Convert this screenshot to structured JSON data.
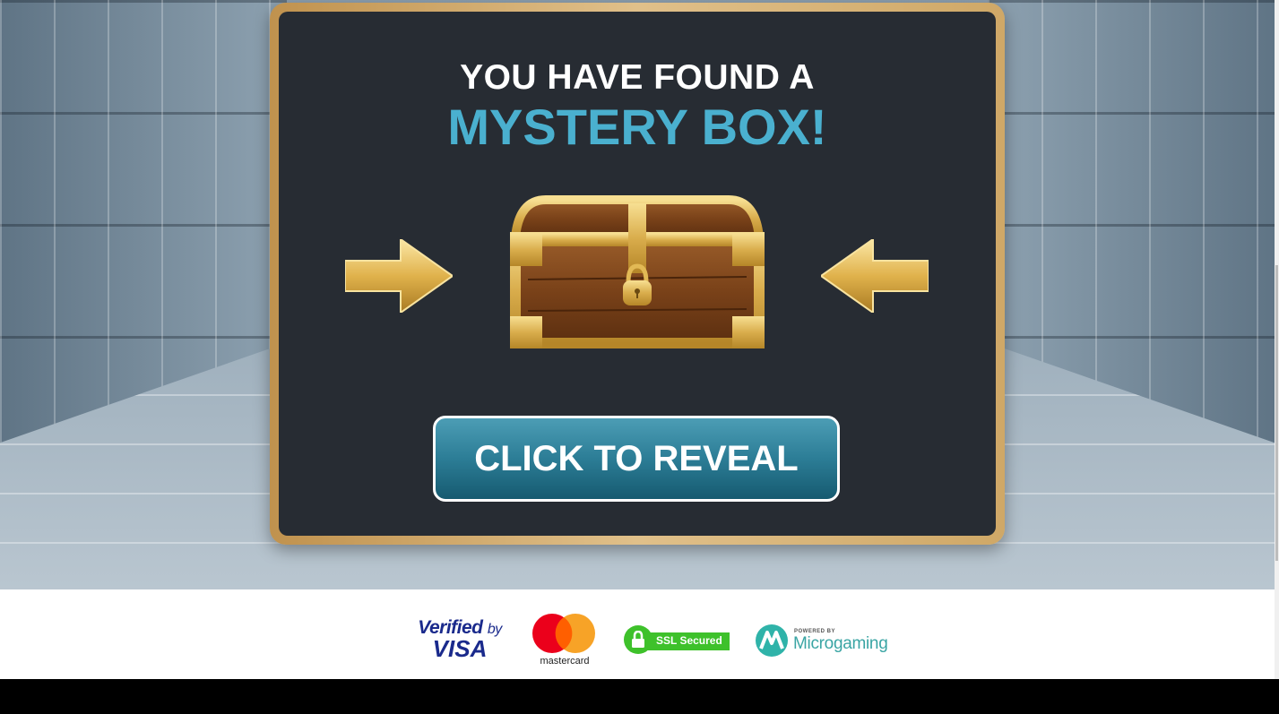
{
  "modal": {
    "headline": "YOU HAVE FOUND A",
    "subheadline": "MYSTERY BOX!",
    "button_label": "CLICK TO REVEAL"
  },
  "icons": {
    "left_arrow": "arrow-right-icon",
    "right_arrow": "arrow-left-icon",
    "chest": "treasure-chest-icon"
  },
  "footer": {
    "visa_line1": "Verified",
    "visa_by": "by",
    "visa_line2": "VISA",
    "mastercard_label": "mastercard",
    "ssl_label": "SSL Secured",
    "microgaming_top": "POWERED BY",
    "microgaming_name": "Microgaming"
  },
  "colors": {
    "card_bg": "#272c33",
    "gold_border": "#d4b074",
    "accent_blue": "#4ab0cf",
    "button_blue": "#2c7d96",
    "ssl_green": "#3ec12b",
    "mastercard_red": "#eb001b",
    "mastercard_orange": "#f79e1b"
  }
}
